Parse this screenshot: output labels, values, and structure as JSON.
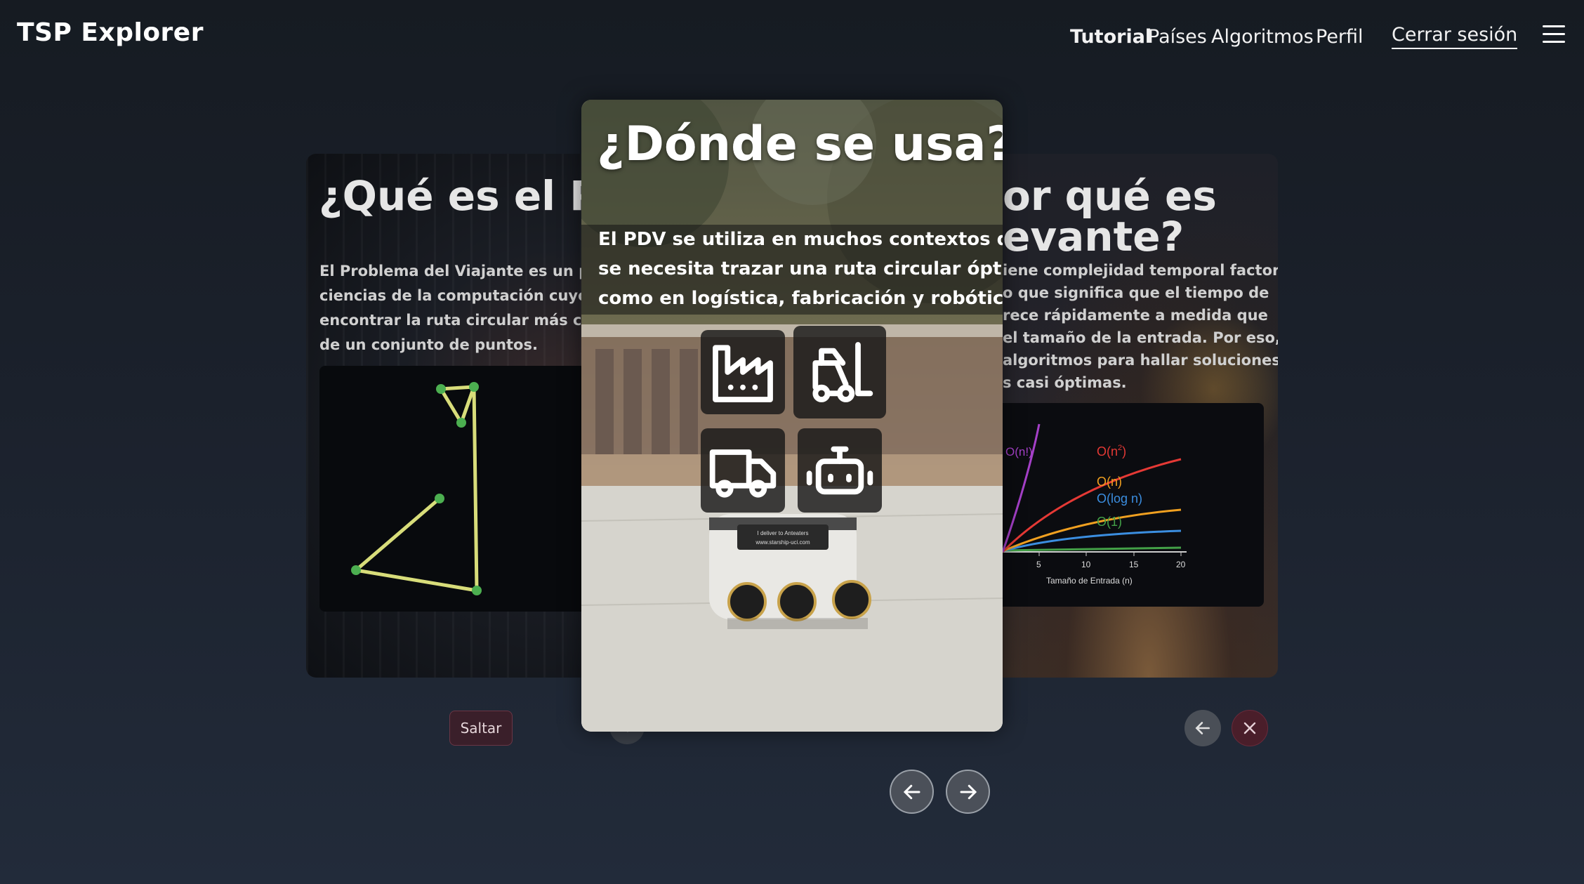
{
  "header": {
    "brand": "TSP Explorer",
    "nav": {
      "tutorial": "Tutorial",
      "paises": "Países",
      "algoritmos": "Algoritmos",
      "perfil": "Perfil"
    },
    "logout": "Cerrar sesión",
    "menu_icon": "hamburger-menu-icon"
  },
  "cards": {
    "left": {
      "title": "¿Qué es el PDV?",
      "title_visible": "¿Qué es el PD",
      "lines": [
        "El Problema del Viajante es un proble",
        "ciencias de la computación cuyo obje",
        "encontrar la ruta circular más corta a",
        "de un conjunto de puntos."
      ]
    },
    "center": {
      "title": "¿Dónde se usa?",
      "lines": [
        "El PDV se utiliza en muchos contextos donde",
        "se necesita trazar una ruta circular óptima,",
        "como en logística, fabricación y robótica."
      ],
      "icons": [
        "factory-icon",
        "forklift-icon",
        "truck-icon",
        "robot-icon"
      ],
      "robot_sign": [
        "I deliver to Anteaters",
        "www.starship-uci.com"
      ]
    },
    "right": {
      "title_line1": "or qué es",
      "title_line2": "evante?",
      "lines": [
        "iene complejidad temporal factorial",
        "o que significa que el tiempo de",
        "rece rápidamente a medida que",
        "el tamaño de la entrada. Por eso, se",
        "algoritmos para hallar soluciones",
        "s casi óptimas."
      ],
      "chart_data": {
        "type": "line",
        "xlabel": "Tamaño de Entrada (n)",
        "x_ticks": [
          "5",
          "10",
          "15",
          "20"
        ],
        "series": [
          {
            "name": "O(n!)",
            "color": "#a540c8"
          },
          {
            "name": "O(n²)",
            "color": "#e53935"
          },
          {
            "name": "O(n)",
            "color": "#f0a020"
          },
          {
            "name": "O(log n)",
            "color": "#3b8ee0"
          },
          {
            "name": "O(1)",
            "color": "#43a047"
          }
        ],
        "labels": {
          "n_fact": "O(n!)",
          "n2": "O(n",
          "n2_sup": "2",
          "n2_close": ")",
          "n": "O(n)",
          "logn": "O(log n)",
          "one": "O(1)"
        }
      }
    }
  },
  "controls": {
    "skip": "Saltar",
    "prev_icon": "arrow-left-icon",
    "next_icon": "arrow-right-icon",
    "close_icon": "close-icon"
  }
}
